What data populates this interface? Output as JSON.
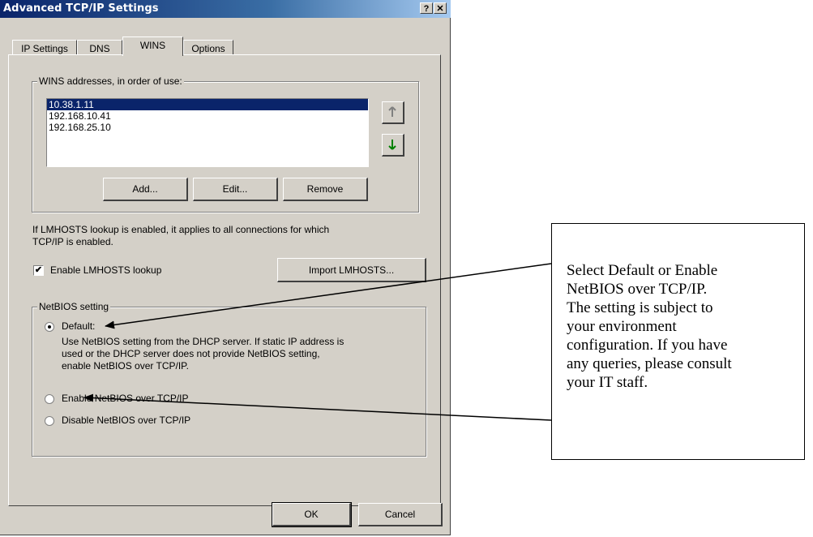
{
  "window": {
    "title": "Advanced TCP/IP Settings",
    "help_label": "?",
    "close_label": "✕"
  },
  "tabs": [
    {
      "label": "IP Settings",
      "active": false
    },
    {
      "label": "DNS",
      "active": false
    },
    {
      "label": "WINS",
      "active": true
    },
    {
      "label": "Options",
      "active": false
    }
  ],
  "wins": {
    "group_label": "WINS addresses, in order of use:",
    "addresses": [
      {
        "value": "10.38.1.11",
        "selected": true
      },
      {
        "value": "192.168.10.41",
        "selected": false
      },
      {
        "value": "192.168.25.10",
        "selected": false
      }
    ],
    "up_icon": "arrow-up-icon",
    "down_icon": "arrow-down-icon",
    "add_label": "Add...",
    "edit_label": "Edit...",
    "remove_label": "Remove"
  },
  "lmhosts": {
    "info_line1": "If LMHOSTS lookup is enabled, it applies to all connections for which",
    "info_line2": "TCP/IP is enabled.",
    "checkbox_label": "Enable LMHOSTS lookup",
    "checked": true,
    "import_label": "Import LMHOSTS..."
  },
  "netbios": {
    "group_label": "NetBIOS setting",
    "options": [
      {
        "label": "Default:",
        "selected": true
      },
      {
        "label": "Enable NetBIOS over TCP/IP",
        "selected": false
      },
      {
        "label": "Disable NetBIOS over TCP/IP",
        "selected": false
      }
    ],
    "default_desc1": "Use NetBIOS setting from the DHCP server. If static IP address is",
    "default_desc2": "used or the DHCP server does not provide NetBIOS setting,",
    "default_desc3": "enable NetBIOS over TCP/IP."
  },
  "footer": {
    "ok_label": "OK",
    "cancel_label": "Cancel"
  },
  "callout": {
    "lines": [
      "Select Default or Enable",
      "NetBIOS over TCP/IP.",
      "The setting is subject to",
      "your environment",
      "configuration.  If you have",
      "any queries, please consult",
      "your IT staff."
    ]
  },
  "colors": {
    "title_bar": "#0a246a",
    "dialog_face": "#d4d0c8",
    "selection": "#0a246a",
    "up_arrow": "#808080",
    "down_arrow": "#008000"
  }
}
